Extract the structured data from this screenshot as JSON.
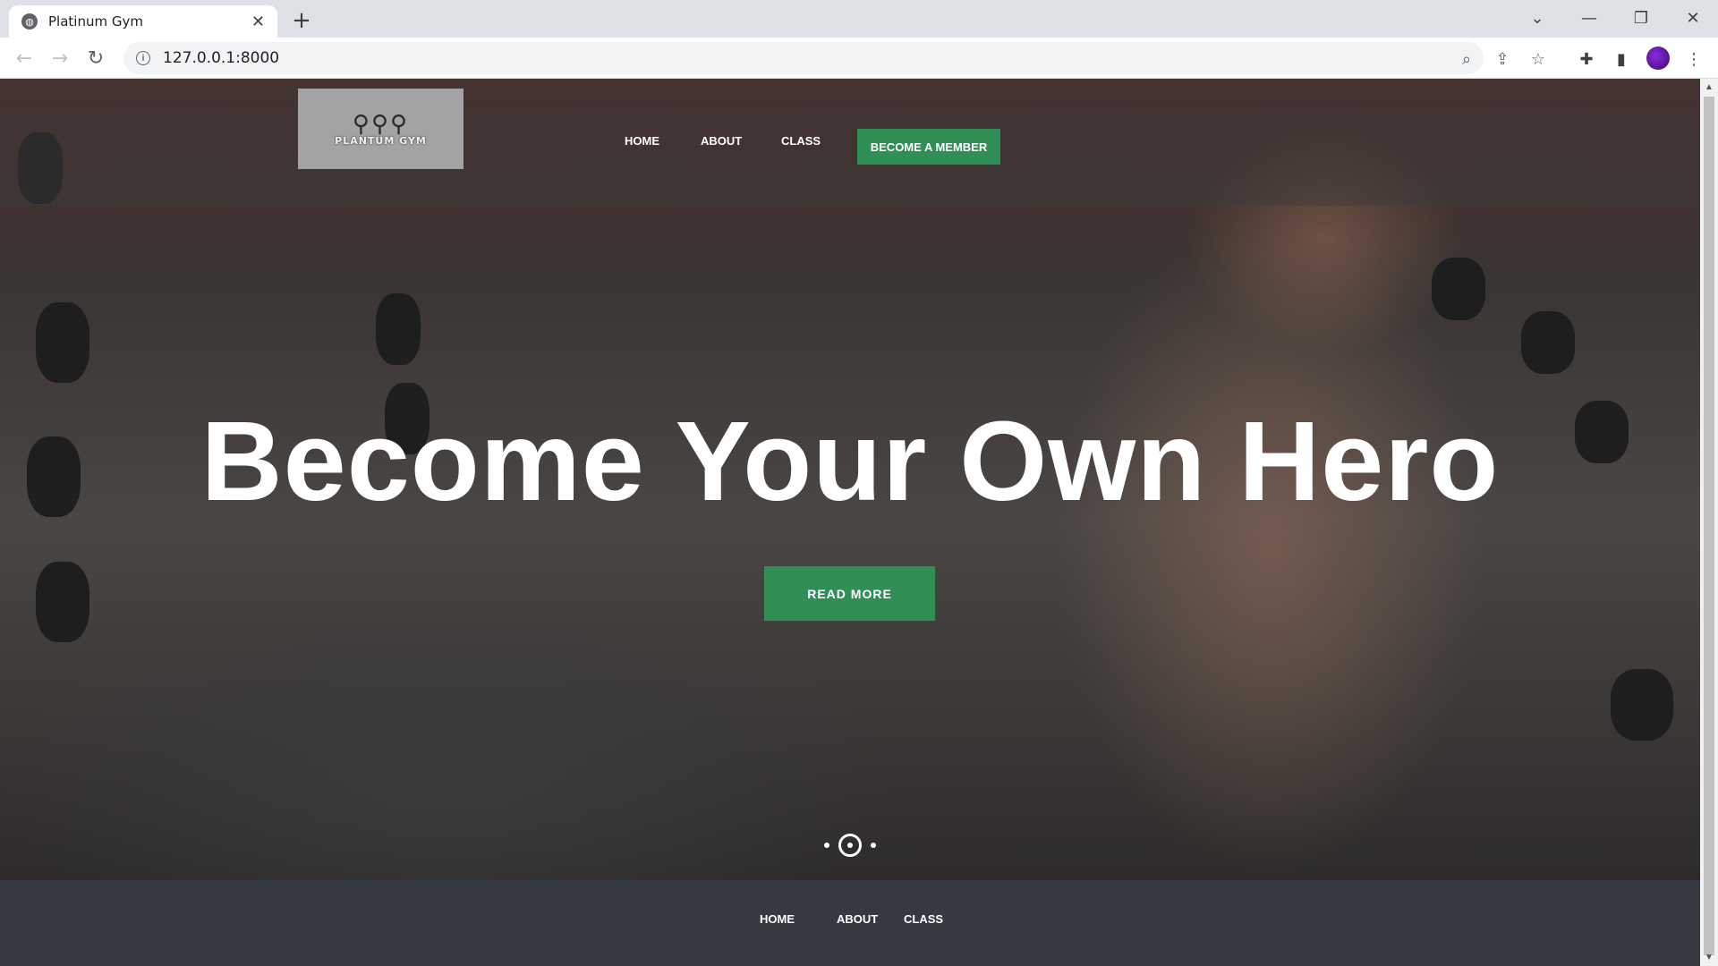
{
  "browser": {
    "tab_title": "Platinum Gym",
    "tab_close": "✕",
    "new_tab": "+",
    "url": "127.0.0.1:8000",
    "window_controls": {
      "dropdown": "⌄",
      "minimize": "—",
      "restore": "❐",
      "close": "✕"
    },
    "nav": {
      "back": "←",
      "forward": "→",
      "reload": "↻"
    },
    "icons": {
      "zoom": "zoom-icon",
      "share": "share-icon",
      "star": "star-icon",
      "extensions": "puzzle-icon",
      "sidepanel": "sidepanel-icon",
      "menu": "⋮"
    }
  },
  "site": {
    "logo_mark": "⚲⚲⚲",
    "logo_text": "PLANTUM GYM",
    "nav": {
      "home": "HOME",
      "about": "ABOUT",
      "class": "CLASS",
      "member": "BECOME A MEMBER"
    },
    "hero": {
      "headline": "Become Your Own Hero",
      "button": "READ MORE"
    },
    "footer": {
      "home": "HOME",
      "about": "ABOUT",
      "class": "CLASS"
    }
  },
  "colors": {
    "accent": "#2f8f57",
    "footer_bg": "#343a40",
    "logo_bg": "#a3a3a3",
    "chrome_tabbar": "#dee1e6"
  }
}
